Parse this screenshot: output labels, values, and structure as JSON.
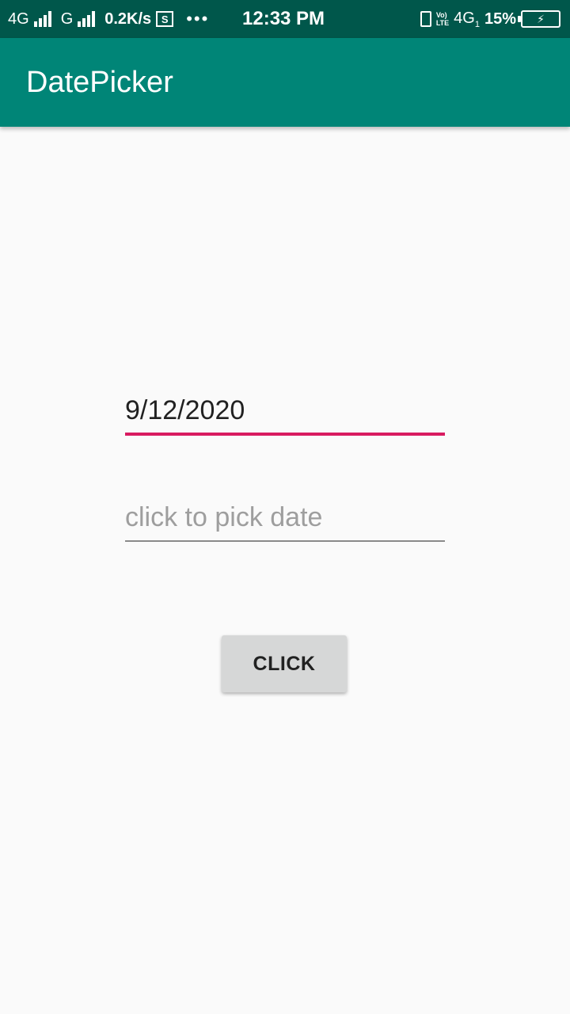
{
  "status_bar": {
    "network1": "4G",
    "network2": "G",
    "speed": "0.2K/s",
    "screenshot_icon": "S",
    "more": "•••",
    "time": "12:33 PM",
    "volte_top": "Vo)",
    "volte_bottom": "LTE",
    "network3": "4G",
    "network3_sub": "1",
    "battery_percent": "15%",
    "battery_icon": "⚡"
  },
  "app_bar": {
    "title": "DatePicker"
  },
  "form": {
    "date_value": "9/12/2020",
    "date2_placeholder": "click to pick date",
    "button_label": "CLICK"
  },
  "colors": {
    "status_bar": "#00574b",
    "app_bar": "#008577",
    "accent": "#d81b60",
    "background": "#fafafa"
  }
}
